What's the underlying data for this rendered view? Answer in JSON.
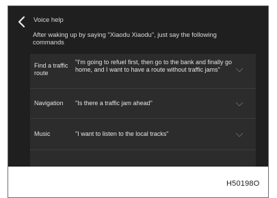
{
  "header": {
    "back_icon": "chevron-left-icon",
    "title": "Voice help"
  },
  "intro": "After waking up by saying \"Xiaodu Xiaodu\", just say the following commands",
  "commands": [
    {
      "label": "Find a traffic route",
      "example": "\"I'm going to refuel first, then go to the bank and finally go home, and I want to have a route without traffic jams\"",
      "icon": "chevron-down-icon"
    },
    {
      "label": "Navigation",
      "example": "\"Is there a traffic jam ahead\"",
      "icon": "chevron-down-icon"
    },
    {
      "label": "Music",
      "example": "\"I want to listen to the local tracks\"",
      "icon": "chevron-down-icon"
    }
  ],
  "figure_id": "H50198O",
  "colors": {
    "screen_bg": "#1f1f1f",
    "list_bg": "#2c2c2c",
    "divider": "#3d3d3d",
    "text": "#e4e4e4",
    "chevron": "#5e5e5e"
  }
}
